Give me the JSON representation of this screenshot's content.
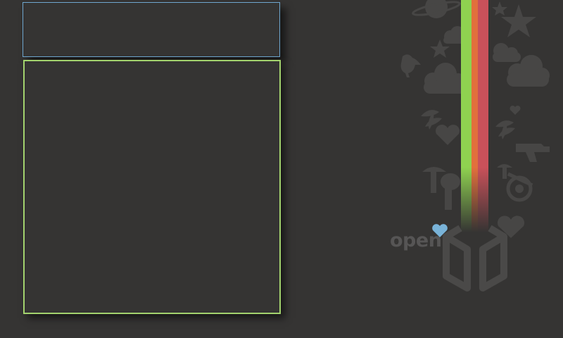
{
  "wallpaper": {
    "brand_text": "open",
    "colors": {
      "background": "#353433",
      "panel_top_border": "#6fa7cf",
      "panel_main_border": "#a3d36e",
      "stripe_green": "#8fd250",
      "stripe_orange": "#e2703c",
      "stripe_red": "#c9515a",
      "heart_blue": "#79b3d8",
      "silhouette": "#474645"
    },
    "icons": [
      "star-icon",
      "cloud-icon",
      "bird-icon",
      "heart-icon",
      "planet-icon",
      "mushroom-icon",
      "gun-icon",
      "leaf-icon",
      "box-logo-icon"
    ]
  }
}
